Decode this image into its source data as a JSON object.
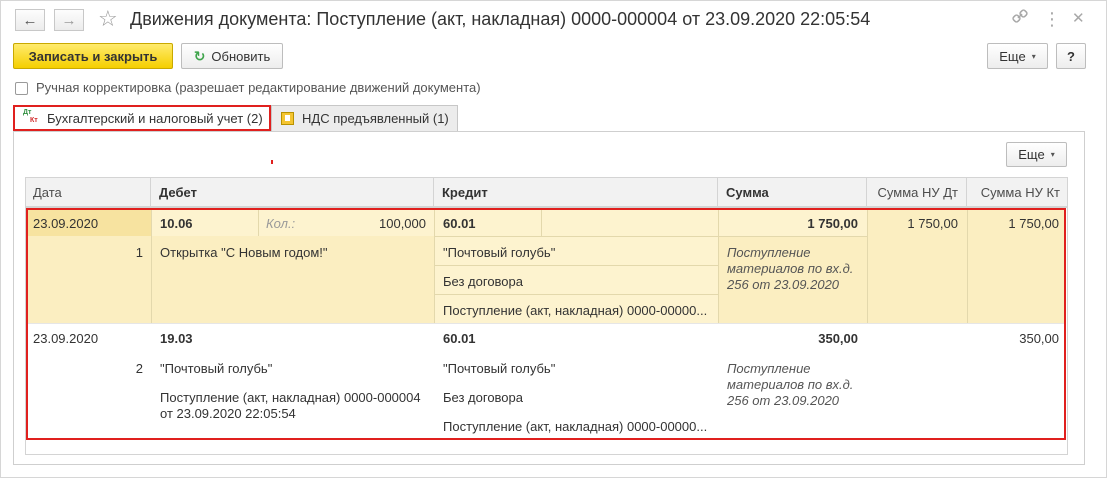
{
  "window": {
    "title": "Движения документа: Поступление (акт, накладная) 0000-000004 от 23.09.2020 22:05:54",
    "back_glyph": "←",
    "forward_glyph": "→",
    "star_glyph": "☆",
    "link_glyph": "🔗",
    "menu_glyph": "⋮",
    "close_glyph": "✕"
  },
  "toolbar": {
    "save_close_label": "Записать и закрыть",
    "refresh_label": "Обновить",
    "refresh_glyph": "↻",
    "more_label": "Еще",
    "caret_glyph": "▾",
    "help_label": "?"
  },
  "manual_correction": {
    "checked": false,
    "label": "Ручная корректировка (разрешает редактирование движений документа)"
  },
  "tabs": [
    {
      "label": "Бухгалтерский и налоговый учет (2)",
      "icon": "dt-kt-icon",
      "icon_dt": "Дт",
      "icon_kt": "Кт",
      "active": true
    },
    {
      "label": "НДС предъявленный (1)",
      "icon": "vat-register-icon",
      "active": false
    }
  ],
  "grid": {
    "more_label": "Еще",
    "columns": {
      "date": "Дата",
      "debit": "Дебет",
      "credit": "Кредит",
      "sum": "Сумма",
      "sum_nu_dt": "Сумма НУ Дт",
      "sum_nu_kt": "Сумма НУ Кт"
    },
    "rows": [
      {
        "date": "23.09.2020",
        "number": "1",
        "debit_account": "10.06",
        "qty_label": "Кол.:",
        "qty_value": "100,000",
        "debit_subconto": [
          "Открытка \"С Новым годом!\""
        ],
        "credit_account": "60.01",
        "credit_subconto": [
          "\"Почтовый голубь\"",
          "Без договора",
          "Поступление (акт, накладная) 0000-00000..."
        ],
        "sum": "1 750,00",
        "content": [
          "Поступление",
          "материалов по вх.д.",
          "256 от 23.09.2020"
        ],
        "sum_nu_dt": "1 750,00",
        "sum_nu_kt": "1 750,00"
      },
      {
        "date": "23.09.2020",
        "number": "2",
        "debit_account": "19.03",
        "debit_subconto": [
          "\"Почтовый голубь\"",
          "Поступление (акт, накладная) 0000-000004",
          "от 23.09.2020 22:05:54"
        ],
        "credit_account": "60.01",
        "credit_subconto": [
          "\"Почтовый голубь\"",
          "Без договора",
          "Поступление (акт, накладная) 0000-00000..."
        ],
        "sum": "350,00",
        "content": [
          "Поступление",
          "материалов по вх.д.",
          "256 от 23.09.2020"
        ],
        "sum_nu_dt": "",
        "sum_nu_kt": "350,00"
      }
    ]
  }
}
